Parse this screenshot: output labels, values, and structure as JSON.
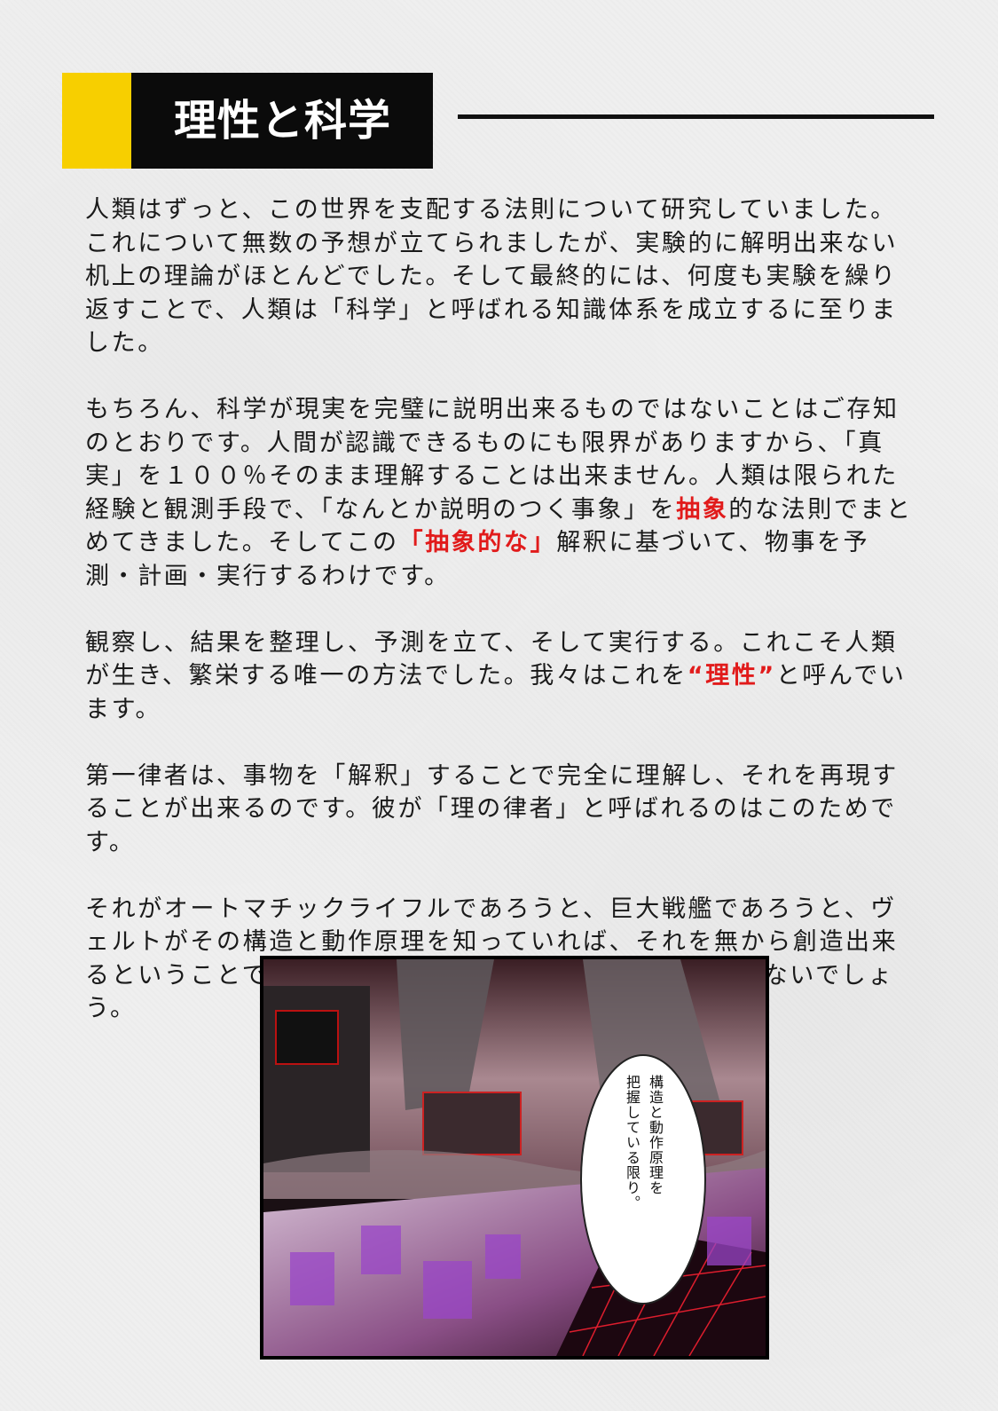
{
  "header": {
    "title": "理性と科学",
    "accent_color": "#f7cf00",
    "block_color": "#0b0b0b"
  },
  "body": {
    "p1": "人類はずっと、この世界を支配する法則について研究していました。これについて無数の予想が立てられましたが、実験的に解明出来ない机上の理論がほとんどでした。そして最終的には、何度も実験を繰り返すことで、人類は「科学」と呼ばれる知識体系を成立するに至りました。",
    "p2": {
      "a": "もちろん、科学が現実を完璧に説明出来るものではないことはご存知のとおりです。人間が認識できるものにも限界がありますから、「真実」を１００％そのまま理解することは出来ません。人類は限られた経験と観測手段で、「なんとか説明のつく事象」を",
      "hl1": "抽象",
      "b": "的な法則でまとめてきました。そしてこの",
      "hl2": "「抽象的な」",
      "c": "解釈に基づいて、物事を予測・計画・実行するわけです。"
    },
    "p3": {
      "a": "観察し、結果を整理し、予測を立て、そして実行する。これこそ人類が生き、繁栄する唯一の方法でした。我々はこれを",
      "hl": "“理性”",
      "b": "と呼んでいます。"
    },
    "p4": "第一律者は、事物を「解釈」することで完全に理解し、それを再現することが出来るのです。彼が「理の律者」と呼ばれるのはこのためです。",
    "p5": "それがオートマチックライフルであろうと、巨大戦艦であろうと、ヴェルトがその構造と動作原理を知っていれば、それを無から創造出来るということです。それが神の鍵であろうと、不可能ではないでしょう。",
    "highlight_color": "#e11b1b"
  },
  "panel": {
    "bubble_line1": "構造と動作原理を",
    "bubble_line2": "把握している限り。"
  }
}
